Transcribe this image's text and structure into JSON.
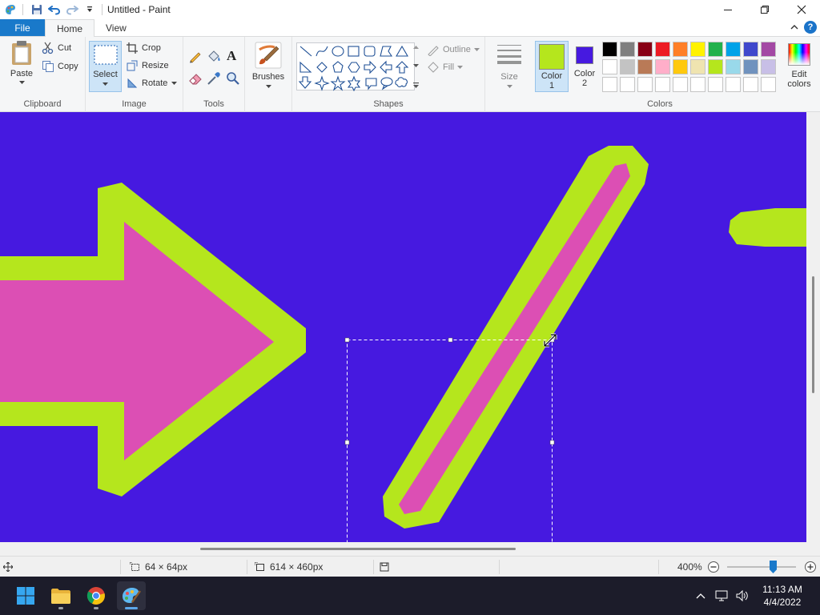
{
  "window": {
    "title": "Untitled - Paint",
    "quick_access": [
      "save-icon",
      "undo-icon",
      "redo-icon",
      "customize-icon"
    ]
  },
  "tabs": [
    {
      "label": "File"
    },
    {
      "label": "Home"
    },
    {
      "label": "View"
    }
  ],
  "ribbon": {
    "clipboard": {
      "label": "Clipboard",
      "paste": "Paste",
      "cut": "Cut",
      "copy": "Copy"
    },
    "image": {
      "label": "Image",
      "select": "Select",
      "crop": "Crop",
      "resize": "Resize",
      "rotate": "Rotate"
    },
    "tools": {
      "label": "Tools",
      "items": [
        "pencil-icon",
        "fill-icon",
        "text-icon",
        "eraser-icon",
        "color-picker-icon",
        "magnifier-icon"
      ]
    },
    "brushes": {
      "label": "Brushes"
    },
    "shapes": {
      "label": "Shapes",
      "outline": "Outline",
      "fill": "Fill"
    },
    "size": {
      "label": "Size"
    },
    "colors": {
      "label": "Colors",
      "color1_label": "Color",
      "color1_num": "1",
      "color2_label": "Color",
      "color2_num": "2",
      "color1": "#b5e61d",
      "color2": "#4619e0",
      "edit_label": "Edit",
      "edit_label2": "colors",
      "palette_row1": [
        "#000000",
        "#7f7f7f",
        "#880015",
        "#ed1c24",
        "#ff7f27",
        "#fff200",
        "#22b14c",
        "#00a2e8",
        "#3f48cc",
        "#a349a4"
      ],
      "palette_row2": [
        "#ffffff",
        "#c3c3c3",
        "#b97a57",
        "#ffaec9",
        "#ffc90e",
        "#efe4b0",
        "#b5e61d",
        "#99d9ea",
        "#7092be",
        "#c8bfe7"
      ]
    }
  },
  "canvas": {
    "background": "#4619e0",
    "outline": "#b5e61d",
    "fill": "#dc4fb4"
  },
  "statusbar": {
    "selection_size": "64 × 64px",
    "image_size": "614 × 460px",
    "zoom": "400%"
  },
  "taskbar": {
    "clock_time": "11:13 AM",
    "clock_date": "4/4/2022"
  }
}
